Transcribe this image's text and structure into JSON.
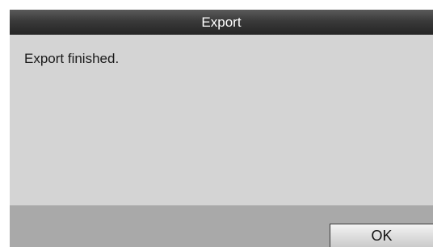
{
  "dialog": {
    "title": "Export",
    "message": "Export finished.",
    "ok_label": "OK"
  }
}
